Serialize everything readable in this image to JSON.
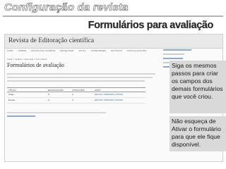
{
  "slide": {
    "title": "Configuração da revista",
    "subtitle": "Formulários para avaliação"
  },
  "screenshot": {
    "site_name": "Revista de Editoração científica",
    "nav": [
      "CAPA",
      "SOBRE",
      "PÁGINA DO USUÁRIO",
      "PESQUISAR",
      "ATUAL",
      "ANTERIORES",
      "NOTÍCIAS",
      "FOCO E ESCOPO"
    ],
    "breadcrumb": "Capa > Usuário > Gerenciar > Formulários",
    "page_heading": "Formulários de avaliação",
    "table": {
      "columns": [
        "TÍTULO",
        "EM AVALIAÇÃO",
        "CONCLUÍDO",
        "AÇÃO"
      ],
      "rows": [
        {
          "title": "Artigo",
          "in_review": "0",
          "completed": "0",
          "actions": "EDITAR | PREVIEW | ATIVAR"
        },
        {
          "title": "Ensaio",
          "in_review": "0",
          "completed": "0",
          "actions": "EDITAR | PREVIEW | ATIVAR"
        }
      ]
    }
  },
  "callouts": [
    "Siga os mesmos passos para criar os campos dos demais formulários que você criou.",
    "Não esqueça de Ativar o formulário para que ele fique disponível."
  ]
}
